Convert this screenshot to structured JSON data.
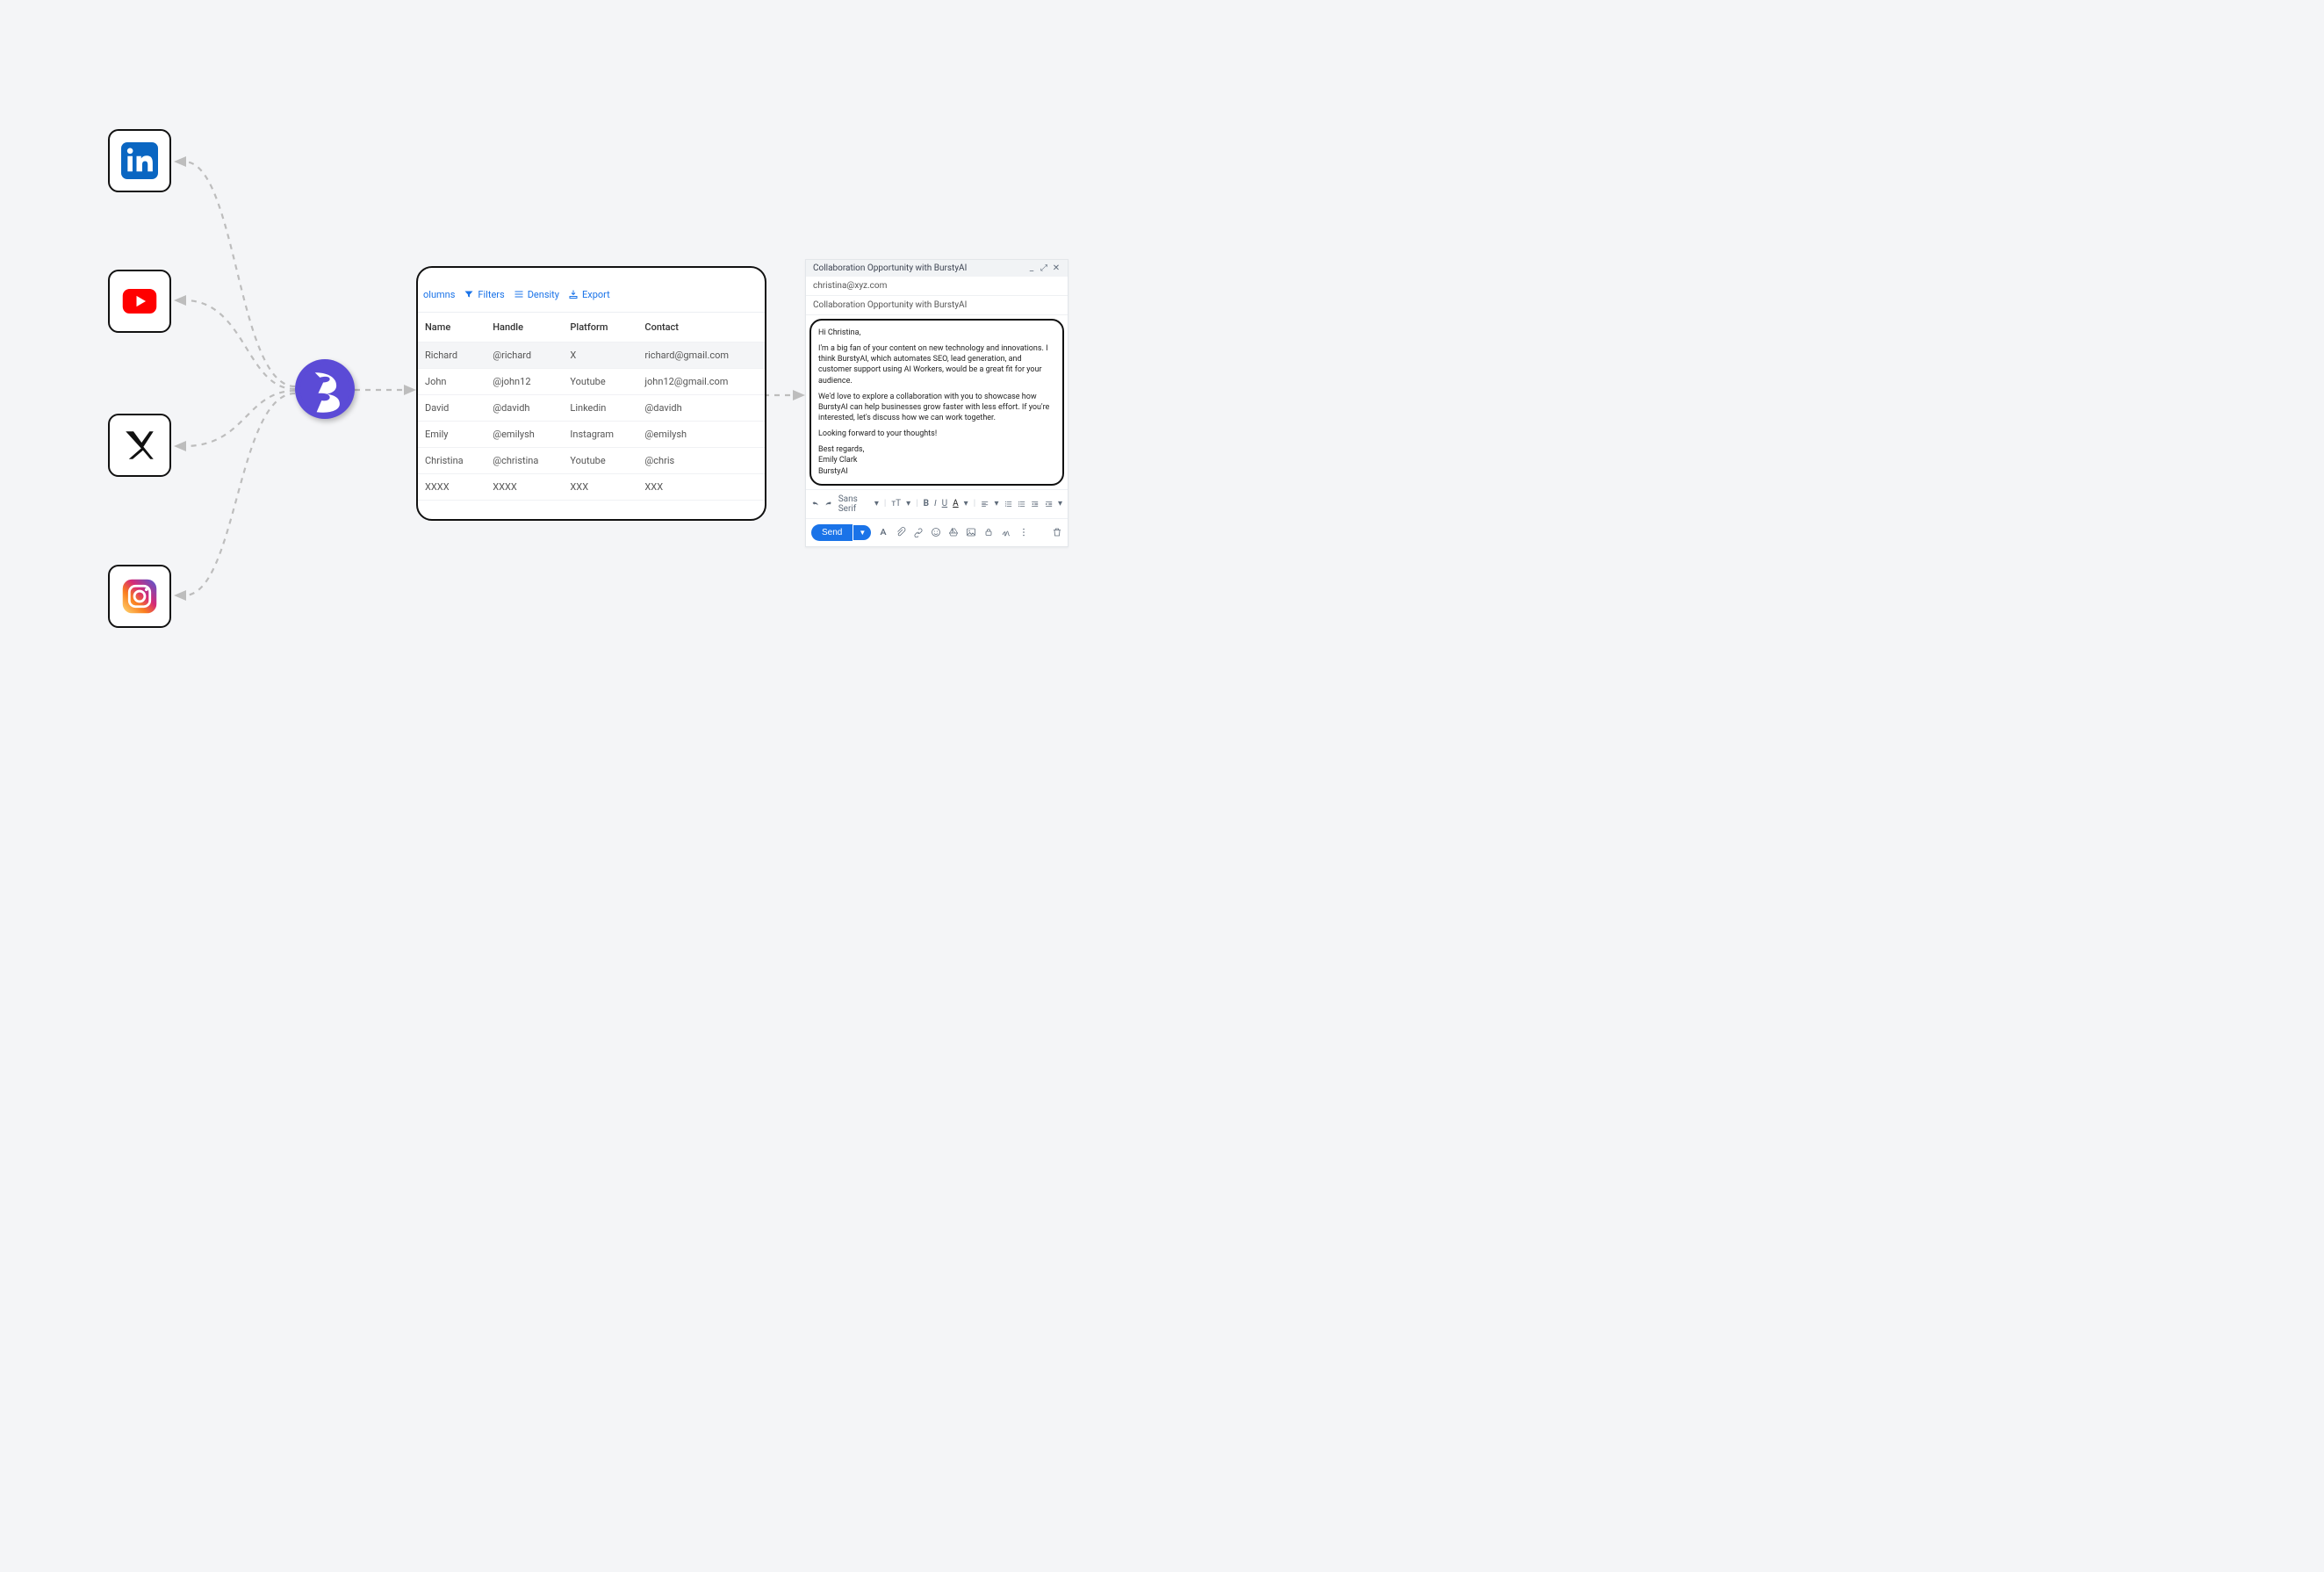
{
  "social_tiles": [
    "linkedin",
    "youtube",
    "x",
    "instagram"
  ],
  "table_toolbar": {
    "columns": "olumns",
    "filters": "Filters",
    "density": "Density",
    "export": "Export"
  },
  "table_headers": [
    "Name",
    "Handle",
    "Platform",
    "Contact"
  ],
  "table_rows": [
    {
      "name": "Richard",
      "handle": "@richard",
      "platform": "X",
      "contact": "richard@gmail.com"
    },
    {
      "name": "John",
      "handle": "@john12",
      "platform": "Youtube",
      "contact": "john12@gmail.com"
    },
    {
      "name": "David",
      "handle": "@davidh",
      "platform": "Linkedin",
      "contact": "@davidh"
    },
    {
      "name": "Emily",
      "handle": "@emilysh",
      "platform": "Instagram",
      "contact": "@emilysh"
    },
    {
      "name": "Christina",
      "handle": "@christina",
      "platform": "Youtube",
      "contact": "@chris"
    },
    {
      "name": "XXXX",
      "handle": "XXXX",
      "platform": "XXX",
      "contact": "XXX"
    }
  ],
  "compose": {
    "title": "Collaboration Opportunity with BurstyAI",
    "to": "christina@xyz.com",
    "subject": "Collaboration Opportunity with BurstyAI",
    "body_p1": "Hi Christina,",
    "body_p2": "I'm a big fan of your content on new technology and innovations. I think BurstyAI, which automates SEO, lead generation, and customer support using AI Workers, would be a great fit for your audience.",
    "body_p3": "We'd love to explore a collaboration with you to showcase how BurstyAI can help businesses grow faster with less effort. If you're interested, let's discuss how we can work together.",
    "body_p4": "Looking forward to your thoughts!",
    "sig1": "Best regards,",
    "sig2": "Emily Clark",
    "sig3": "BurstyAI",
    "font": "Sans Serif",
    "send": "Send"
  }
}
